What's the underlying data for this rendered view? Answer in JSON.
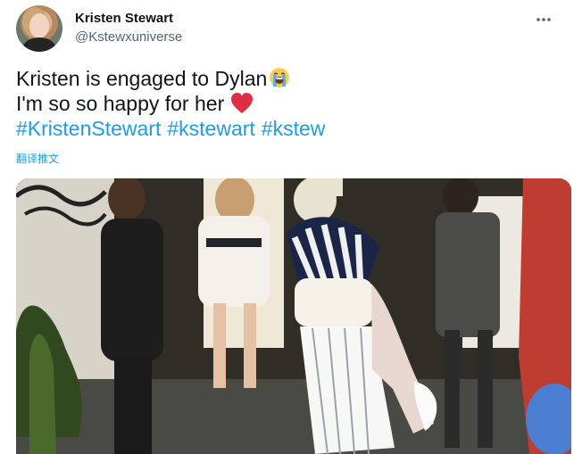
{
  "author": {
    "display_name": "Kristen Stewart",
    "handle": "@Kstewxuniverse",
    "avatar": "profile-photo"
  },
  "tweet": {
    "line1": "Kristen is engaged to Dylan",
    "line1_emoji": "loudly-crying-face-emoji",
    "line2": "I'm so so happy for her",
    "line2_emoji": "red-heart-emoji",
    "hashtags": [
      "#KristenStewart",
      "#kstewart",
      "#kstew"
    ]
  },
  "translate_label": "翻译推文",
  "menu_icon": "more-horizontal-icon",
  "media": {
    "type": "photo"
  },
  "colors": {
    "link": "#1d9bf0",
    "text": "#0f1419",
    "secondary": "#536471"
  }
}
